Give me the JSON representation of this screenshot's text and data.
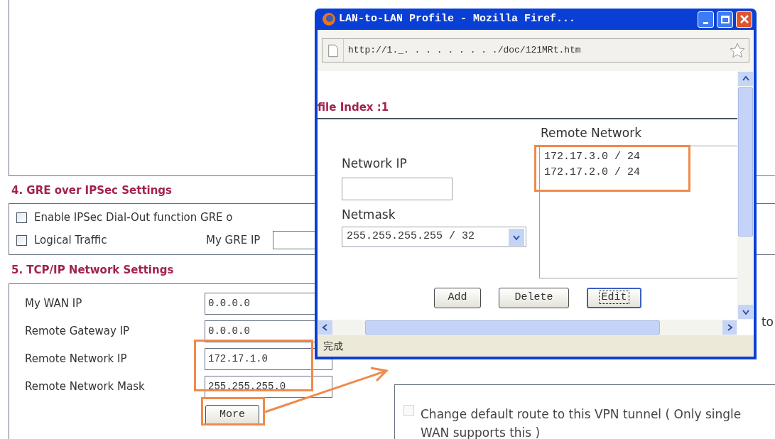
{
  "gre_section": {
    "title": "4. GRE over IPSec Settings",
    "options": [
      {
        "label": "Enable IPSec Dial-Out function GRE o",
        "checked": false
      },
      {
        "label": "Logical Traffic",
        "checked": false
      }
    ],
    "gre_ip_label": "My GRE IP"
  },
  "tcpip_section": {
    "title": "5. TCP/IP Network Settings",
    "fields": [
      {
        "label": "My WAN IP",
        "value": "0.0.0.0"
      },
      {
        "label": "Remote Gateway IP",
        "value": "0.0.0.0"
      },
      {
        "label": "Remote Network IP",
        "value": "172.17.1.0"
      },
      {
        "label": "Remote Network Mask",
        "value": "255.255.255.0"
      }
    ],
    "more_button": "More",
    "side_text": "to",
    "default_route": {
      "label": "Change default route to this VPN tunnel ( Only single WAN supports this )",
      "checked": false,
      "disabled": true
    }
  },
  "popup": {
    "title": "LAN-to-LAN Profile - Mozilla Firef...",
    "url": "http://1._. . . . . . . . ./doc/121MRt.htm",
    "heading": "file Index :1",
    "network_ip_label": "Network IP",
    "netmask_label": "Netmask",
    "netmask_value": "255.255.255.255 / 32",
    "remote_network_label": "Remote Network",
    "remote_networks": [
      "172.17.3.0 / 24",
      "172.17.2.0 / 24"
    ],
    "buttons": [
      {
        "label": "Add",
        "focused": false
      },
      {
        "label": "Delete",
        "focused": false
      },
      {
        "label": "Edit",
        "focused": true
      }
    ],
    "status": "完成"
  }
}
